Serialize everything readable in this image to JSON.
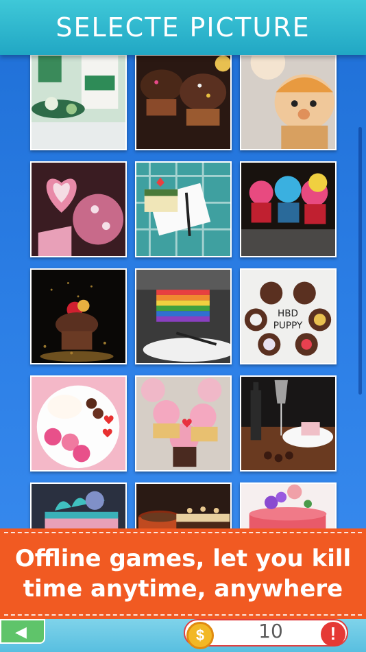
{
  "header": {
    "title": "SELECTE PICTURE"
  },
  "pictures": [
    {
      "name": "picture-green-cookies",
      "palette": [
        "#d8e8d0",
        "#2e8b57",
        "#ffffff"
      ]
    },
    {
      "name": "picture-chocolate-cupcakes",
      "palette": [
        "#2b1a14",
        "#8a4a2a",
        "#f0d8c0"
      ]
    },
    {
      "name": "picture-bear-cupcake",
      "palette": [
        "#d8c8b8",
        "#e8a050",
        "#f7e2c8"
      ]
    },
    {
      "name": "picture-heart-cookies",
      "palette": [
        "#3a1a22",
        "#e88aa8",
        "#f5d0dc"
      ]
    },
    {
      "name": "picture-matcha-cake-slice",
      "palette": [
        "#3fa0a0",
        "#f0e6b8",
        "#4a7a3a"
      ]
    },
    {
      "name": "picture-swirl-cupcakes",
      "palette": [
        "#1a1410",
        "#3ab0e0",
        "#e84a80"
      ]
    },
    {
      "name": "picture-gold-dust-cupcake",
      "palette": [
        "#0a0806",
        "#d8a840",
        "#5a3020"
      ]
    },
    {
      "name": "picture-rainbow-cake",
      "palette": [
        "#3a3a3a",
        "#e84040",
        "#40a040"
      ]
    },
    {
      "name": "picture-hbd-puppy-cupcakes",
      "palette": [
        "#f0f0ee",
        "#5a3020",
        "#e8c050"
      ]
    },
    {
      "name": "picture-macaron-plate",
      "palette": [
        "#f4b8c8",
        "#e8508a",
        "#ffffff"
      ]
    },
    {
      "name": "picture-pink-cupcakes",
      "palette": [
        "#d8d0c8",
        "#f0a0b8",
        "#e8c070"
      ]
    },
    {
      "name": "picture-wine-dessert",
      "palette": [
        "#1a1818",
        "#6a3a20",
        "#f0c0c8"
      ]
    },
    {
      "name": "picture-teal-layer-cake",
      "palette": [
        "#2a3040",
        "#40c0c0",
        "#e8a0b8"
      ]
    },
    {
      "name": "picture-coffee-cake",
      "palette": [
        "#2a1a14",
        "#c04a20",
        "#6a3a20"
      ]
    },
    {
      "name": "picture-pink-flower-cake",
      "palette": [
        "#f8f0f0",
        "#e85a6a",
        "#8a4ad0"
      ]
    }
  ],
  "picture_texts": {
    "hbd_line1": "HBD",
    "hbd_line2": "PUPPY"
  },
  "banner": {
    "line1": "Offline games, let you kill",
    "line2": "time anytime, anywhere"
  },
  "bottom": {
    "coin_count": "10",
    "coin_symbol": "$",
    "add_symbol": "!"
  }
}
